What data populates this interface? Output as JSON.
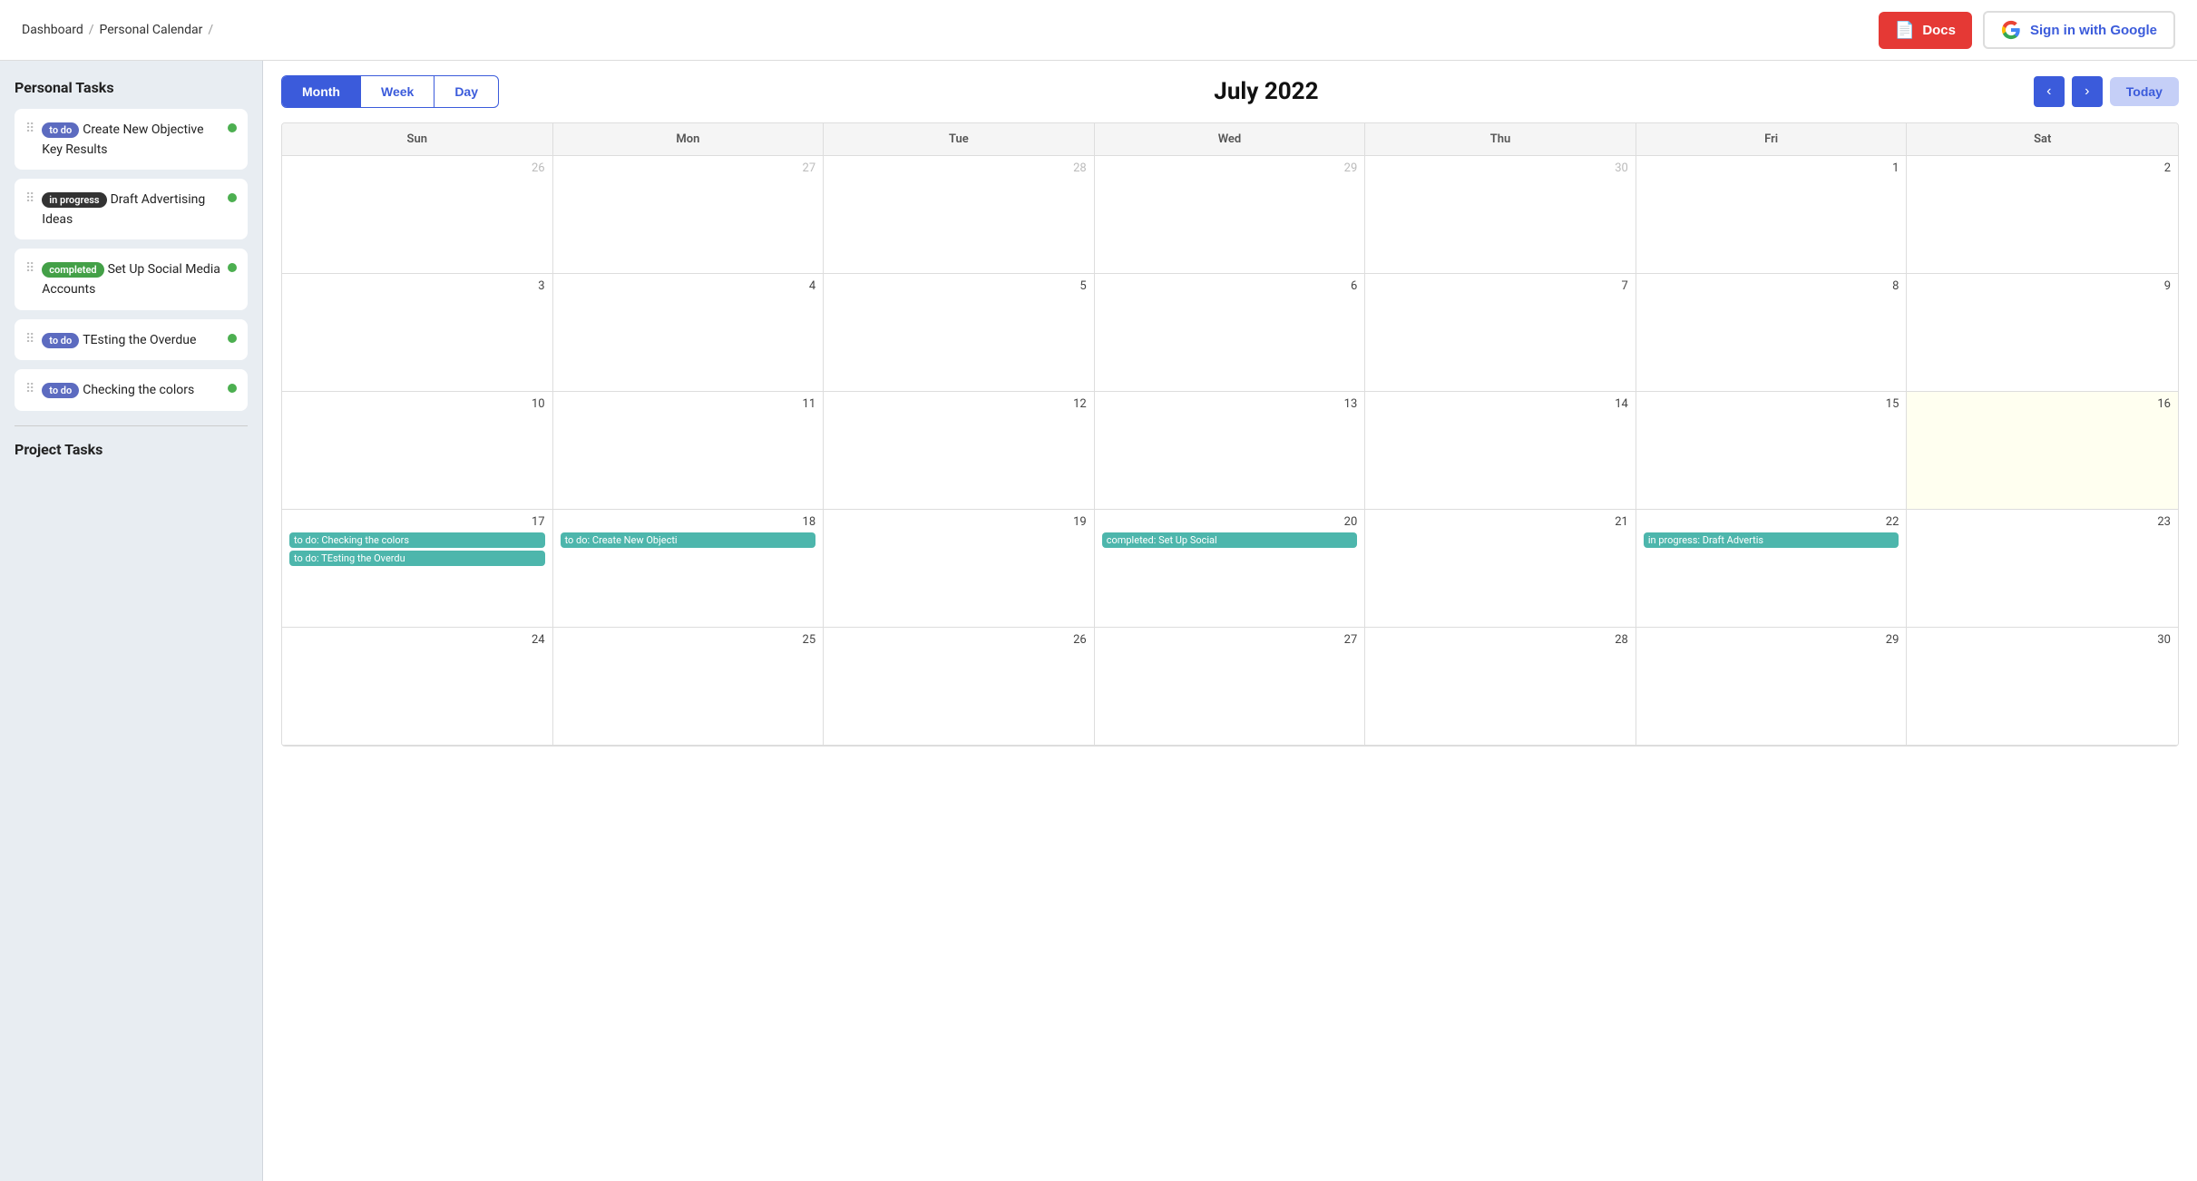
{
  "breadcrumb": {
    "items": [
      "Dashboard",
      "Personal Calendar"
    ]
  },
  "header": {
    "docs_label": "Docs",
    "google_label": "Sign in with Google"
  },
  "calendar": {
    "title": "July 2022",
    "view_tabs": [
      "Month",
      "Week",
      "Day"
    ],
    "active_tab": "Month",
    "today_label": "Today",
    "days_of_week": [
      "Sun",
      "Mon",
      "Tue",
      "Wed",
      "Thu",
      "Fri",
      "Sat"
    ],
    "rows": [
      [
        {
          "day": "26",
          "other": true
        },
        {
          "day": "27",
          "other": true
        },
        {
          "day": "28",
          "other": true
        },
        {
          "day": "29",
          "other": true
        },
        {
          "day": "30",
          "other": true
        },
        {
          "day": "1",
          "events": []
        },
        {
          "day": "2",
          "events": []
        }
      ],
      [
        {
          "day": "3",
          "events": []
        },
        {
          "day": "4",
          "events": []
        },
        {
          "day": "5",
          "events": []
        },
        {
          "day": "6",
          "events": []
        },
        {
          "day": "7",
          "events": []
        },
        {
          "day": "8",
          "events": []
        },
        {
          "day": "9",
          "events": []
        }
      ],
      [
        {
          "day": "10",
          "events": []
        },
        {
          "day": "11",
          "events": []
        },
        {
          "day": "12",
          "events": []
        },
        {
          "day": "13",
          "events": []
        },
        {
          "day": "14",
          "events": []
        },
        {
          "day": "15",
          "events": []
        },
        {
          "day": "16",
          "today": true,
          "events": []
        }
      ],
      [
        {
          "day": "17",
          "events": [
            {
              "text": "to do: Checking the colors"
            },
            {
              "text": "to do: TEsting the Overdu"
            }
          ]
        },
        {
          "day": "18",
          "events": [
            {
              "text": "to do: Create New Objecti"
            }
          ]
        },
        {
          "day": "19",
          "events": []
        },
        {
          "day": "20",
          "events": [
            {
              "text": "completed: Set Up Social"
            }
          ]
        },
        {
          "day": "21",
          "events": []
        },
        {
          "day": "22",
          "events": [
            {
              "text": "in progress: Draft Advertis"
            }
          ]
        },
        {
          "day": "23",
          "events": []
        }
      ],
      [
        {
          "day": "24",
          "events": []
        },
        {
          "day": "25",
          "events": []
        },
        {
          "day": "26",
          "events": []
        },
        {
          "day": "27",
          "events": []
        },
        {
          "day": "28",
          "events": []
        },
        {
          "day": "29",
          "events": []
        },
        {
          "day": "30",
          "events": []
        }
      ]
    ]
  },
  "personal_tasks": {
    "title": "Personal Tasks",
    "items": [
      {
        "badge": "to do",
        "badge_type": "todo",
        "title": "Create New Objective Key Results"
      },
      {
        "badge": "in progress",
        "badge_type": "inprogress",
        "title": "Draft Advertising Ideas"
      },
      {
        "badge": "completed",
        "badge_type": "completed",
        "title": "Set Up Social Media Accounts"
      },
      {
        "badge": "to do",
        "badge_type": "todo",
        "title": "TEsting the Overdue"
      },
      {
        "badge": "to do",
        "badge_type": "todo",
        "title": "Checking the colors"
      }
    ]
  },
  "project_tasks": {
    "title": "Project Tasks"
  }
}
